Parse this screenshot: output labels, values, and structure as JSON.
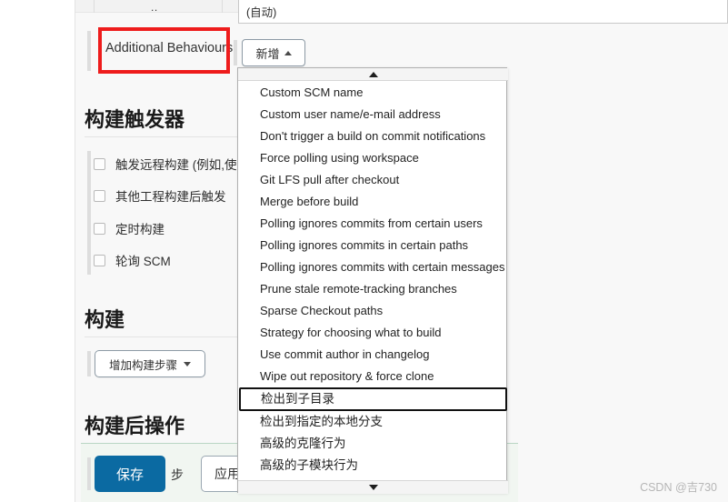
{
  "form": {
    "auto_field_value": "(自动)",
    "cut_label_fragment": "..",
    "additional_behaviours_label": "Additional Behaviours",
    "add_button_label": "新增"
  },
  "sections": {
    "build_triggers": {
      "heading": "构建触发器",
      "checkboxes": [
        {
          "label": "触发远程构建 (例如,使"
        },
        {
          "label": "其他工程构建后触发"
        },
        {
          "label": "定时构建"
        },
        {
          "label": "轮询 SCM"
        }
      ]
    },
    "build": {
      "heading": "构建",
      "add_step_button": "增加构建步骤"
    },
    "post_build": {
      "heading": "构建后操作"
    }
  },
  "actions": {
    "save_label": "保存",
    "secondary_label": "应用",
    "secondary_glyph": "步"
  },
  "dropdown": {
    "scroll_up_icon": "triangle-up-icon",
    "scroll_down_icon": "triangle-down-icon",
    "selected_item": "检出到子目录",
    "items": [
      {
        "label": "Custom SCM name",
        "selected": false,
        "cjk": false
      },
      {
        "label": "Custom user name/e-mail address",
        "selected": false,
        "cjk": false
      },
      {
        "label": "Don't trigger a build on commit notifications",
        "selected": false,
        "cjk": false
      },
      {
        "label": "Force polling using workspace",
        "selected": false,
        "cjk": false
      },
      {
        "label": "Git LFS pull after checkout",
        "selected": false,
        "cjk": false
      },
      {
        "label": "Merge before build",
        "selected": false,
        "cjk": false
      },
      {
        "label": "Polling ignores commits from certain users",
        "selected": false,
        "cjk": false
      },
      {
        "label": "Polling ignores commits in certain paths",
        "selected": false,
        "cjk": false
      },
      {
        "label": "Polling ignores commits with certain messages",
        "selected": false,
        "cjk": false
      },
      {
        "label": "Prune stale remote-tracking branches",
        "selected": false,
        "cjk": false
      },
      {
        "label": "Sparse Checkout paths",
        "selected": false,
        "cjk": false
      },
      {
        "label": "Strategy for choosing what to build",
        "selected": false,
        "cjk": false
      },
      {
        "label": "Use commit author in changelog",
        "selected": false,
        "cjk": false
      },
      {
        "label": "Wipe out repository & force clone",
        "selected": false,
        "cjk": false
      },
      {
        "label": "检出到子目录",
        "selected": true,
        "cjk": true
      },
      {
        "label": "检出到指定的本地分支",
        "selected": false,
        "cjk": true
      },
      {
        "label": "高级的克隆行为",
        "selected": false,
        "cjk": true
      },
      {
        "label": "高级的子模块行为",
        "selected": false,
        "cjk": true
      }
    ]
  },
  "annotations": {
    "highlight_color": "#ee1c1c",
    "boxes": [
      {
        "name": "additional-behaviours-highlight"
      },
      {
        "name": "checkout-subdirectory-highlight"
      }
    ]
  },
  "watermark": "CSDN @吉730"
}
